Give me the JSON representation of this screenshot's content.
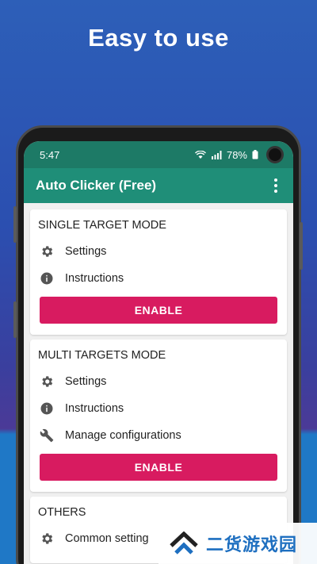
{
  "headline": "Easy to use",
  "status": {
    "time": "5:47",
    "battery": "78%"
  },
  "appbar": {
    "title": "Auto Clicker (Free)"
  },
  "cards": [
    {
      "title": "SINGLE TARGET MODE",
      "items": [
        {
          "icon": "gear-icon",
          "label": "Settings"
        },
        {
          "icon": "info-icon",
          "label": "Instructions"
        }
      ],
      "button": "ENABLE"
    },
    {
      "title": "MULTI TARGETS MODE",
      "items": [
        {
          "icon": "gear-icon",
          "label": "Settings"
        },
        {
          "icon": "info-icon",
          "label": "Instructions"
        },
        {
          "icon": "wrench-icon",
          "label": "Manage configurations"
        }
      ],
      "button": "ENABLE"
    },
    {
      "title": "OTHERS",
      "items": [
        {
          "icon": "gear-icon",
          "label": "Common setting"
        }
      ]
    }
  ],
  "watermark": {
    "text": "二货游戏园"
  },
  "colors": {
    "appbar": "#1f8e78",
    "statusbar": "#1d7a66",
    "enable_button": "#d81b60",
    "background_top": "#2d5fb8",
    "background_bottom": "#1f78c6"
  }
}
